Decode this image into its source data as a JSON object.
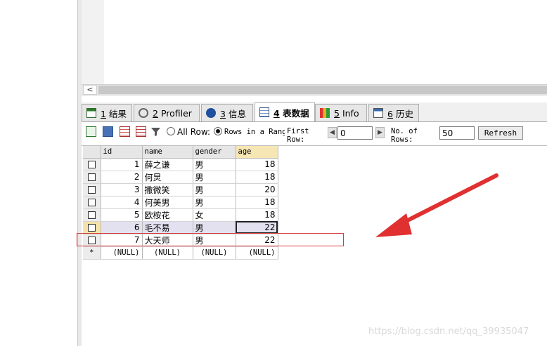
{
  "tabs": [
    {
      "num": "1",
      "label": "结果",
      "icon": "grid-result-icon"
    },
    {
      "num": "2",
      "label": "Profiler",
      "icon": "profiler-icon"
    },
    {
      "num": "3",
      "label": "信息",
      "icon": "info-icon"
    },
    {
      "num": "4",
      "label": "表数据",
      "icon": "table-data-icon"
    },
    {
      "num": "5",
      "label": "Info",
      "icon": "chart-info-icon"
    },
    {
      "num": "6",
      "label": "历史",
      "icon": "calendar-history-icon"
    }
  ],
  "toolbar": {
    "radio_all": "All Row:",
    "radio_range": "Rows in a Range",
    "first_row_label_1": "First",
    "first_row_label_2": "Row:",
    "first_row_value": "0",
    "rows_label_1": "No. of",
    "rows_label_2": "Rows:",
    "rows_value": "50",
    "refresh_label": "Refresh"
  },
  "grid": {
    "columns": [
      "id",
      "name",
      "gender",
      "age"
    ],
    "rows": [
      {
        "id": "1",
        "name": "薛之谦",
        "gender": "男",
        "age": "18"
      },
      {
        "id": "2",
        "name": "何炅",
        "gender": "男",
        "age": "18"
      },
      {
        "id": "3",
        "name": "撒微笑",
        "gender": "男",
        "age": "20"
      },
      {
        "id": "4",
        "name": "何美男",
        "gender": "男",
        "age": "18"
      },
      {
        "id": "5",
        "name": "欧桉花",
        "gender": "女",
        "age": "18"
      },
      {
        "id": "6",
        "name": "毛不易",
        "gender": "男",
        "age": "22"
      },
      {
        "id": "7",
        "name": "大天师",
        "gender": "男",
        "age": "22"
      }
    ],
    "null_marker": "*",
    "null_value": "(NULL)"
  },
  "watermark": "https://blog.csdn.net/qq_39935047",
  "colors": {
    "annotation": "#e03030",
    "highlight_row": "#e3e1f0",
    "sort_header": "#f6e6b4"
  }
}
